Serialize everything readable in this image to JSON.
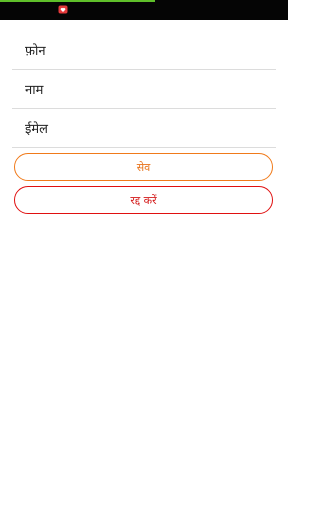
{
  "form": {
    "phone_placeholder": "फ़ोन",
    "name_placeholder": "नाम",
    "email_placeholder": "ईमेल"
  },
  "actions": {
    "save_label": "सेव",
    "cancel_label": "रद्द करें"
  },
  "colors": {
    "status_bar": "#050505",
    "progress": "#5fbf2a",
    "save_accent": "#f07a1a",
    "cancel_accent": "#e01010",
    "notification_icon": "#e5393b"
  },
  "status": {
    "notification_icon": "notification-app-icon"
  }
}
